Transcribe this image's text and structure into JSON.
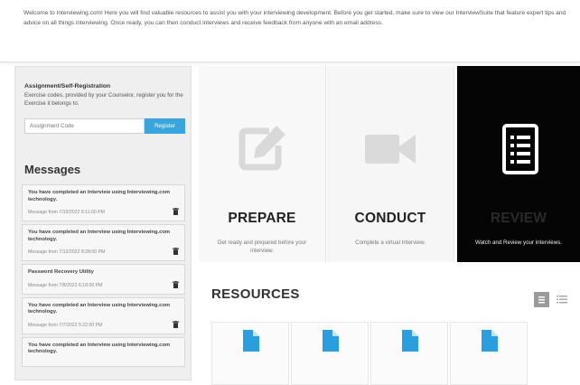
{
  "welcome": {
    "text": "Welcome to Interviewing.com! Here you will find valuable resources to assist you with your interviewing development. Before you get started, make sure to view our InterviewSuite that feature expert tips and advice on all things interviewing. Once ready, you can then conduct interviews and receive feedback from anyone with an email address."
  },
  "sidebar": {
    "registration": {
      "title": "Assignment/Self-Registration",
      "description": "Exercise codes, provided by your Counselor, register you for the Exercise it belongs to.",
      "input_placeholder": "Assignment Code",
      "button_label": "Register"
    },
    "messages": {
      "title": "Messages",
      "items": [
        {
          "subject": "You have completed an Interview using Interviewing.com technology.",
          "meta": "Message from 7/15/2022 8:11:00 PM"
        },
        {
          "subject": "You have completed an Interview using Interviewing.com technology.",
          "meta": "Message from 7/12/2022 8:28:00 PM"
        },
        {
          "subject": "Password Recovery Utility",
          "meta": "Message from 7/8/2022 6:18:00 PM"
        },
        {
          "subject": "You have completed an Interview using Interviewing.com technology.",
          "meta": "Message from 7/7/2022 5:22:00 PM"
        },
        {
          "subject": "You have completed an Interview using Interviewing.com technology.",
          "meta": ""
        }
      ]
    }
  },
  "cards": {
    "prepare": {
      "title": "PREPARE",
      "description": "Get ready and prepared before your interview.",
      "icon": "edit-icon"
    },
    "conduct": {
      "title": "CONDUCT",
      "description": "Complete a virtual Interview.",
      "icon": "video-camera-icon"
    },
    "review": {
      "title": "REVIEW",
      "description": "Watch and Review your interviews.",
      "icon": "list-document-icon"
    }
  },
  "resources": {
    "title": "RESOURCES",
    "view_icons": [
      "grid-view-icon",
      "list-view-icon"
    ],
    "file_icon": "document-icon",
    "file_count": 4
  },
  "colors": {
    "accent": "#3aa4dc",
    "review_bg": "#050505",
    "sidebar_bg": "#efefef",
    "file_blue": "#2b9ee0"
  }
}
